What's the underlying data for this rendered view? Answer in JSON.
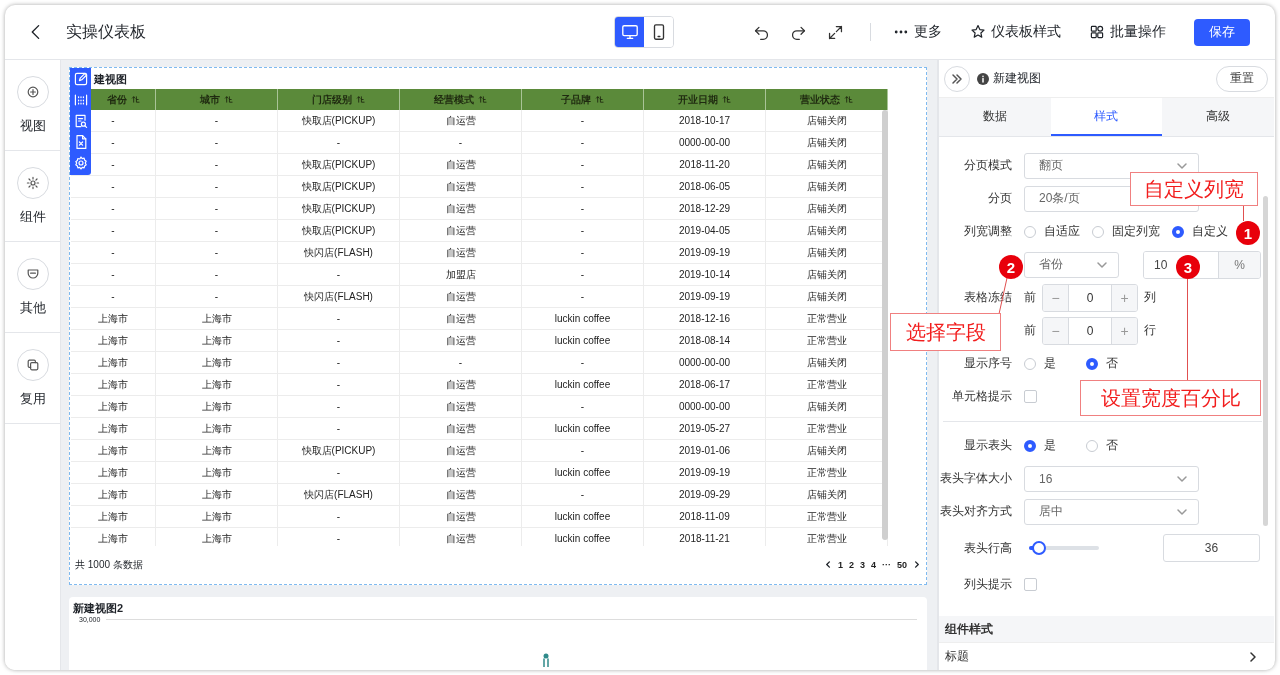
{
  "header": {
    "title": "实操仪表板",
    "devices": [
      {
        "kind": "desktop",
        "selected": true
      },
      {
        "kind": "mobile",
        "selected": false
      }
    ],
    "tools": [
      {
        "kind": "undo"
      },
      {
        "kind": "redo"
      },
      {
        "kind": "expand"
      }
    ],
    "menu": [
      {
        "kind": "more",
        "label": "更多"
      },
      {
        "kind": "style",
        "label": "仪表板样式"
      },
      {
        "kind": "batch",
        "label": "批量操作"
      }
    ],
    "save": "保存"
  },
  "sidebar": {
    "items": [
      {
        "kind": "add",
        "label": "视图"
      },
      {
        "kind": "component",
        "label": "组件"
      },
      {
        "kind": "other",
        "label": "其他"
      },
      {
        "kind": "reuse",
        "label": "复用"
      }
    ]
  },
  "table_view": {
    "title": "建视图",
    "tools": [
      {
        "kind": "edit"
      },
      {
        "kind": "grid"
      },
      {
        "kind": "search"
      },
      {
        "kind": "export"
      },
      {
        "kind": "settings"
      }
    ],
    "columns": [
      {
        "label": "省份",
        "sortable": true
      },
      {
        "label": "城市",
        "sortable": true
      },
      {
        "label": "门店级别",
        "sortable": true
      },
      {
        "label": "经营模式",
        "sortable": true
      },
      {
        "label": "子品牌",
        "sortable": true
      },
      {
        "label": "开业日期",
        "sortable": true
      },
      {
        "label": "营业状态",
        "sortable": true
      }
    ],
    "rows": [
      [
        "-",
        "-",
        "快取店(PICKUP)",
        "自运营",
        "-",
        "2018-10-17",
        "店铺关闭"
      ],
      [
        "-",
        "-",
        "-",
        "-",
        "-",
        "0000-00-00",
        "店铺关闭"
      ],
      [
        "-",
        "-",
        "快取店(PICKUP)",
        "自运营",
        "-",
        "2018-11-20",
        "店铺关闭"
      ],
      [
        "-",
        "-",
        "快取店(PICKUP)",
        "自运营",
        "-",
        "2018-06-05",
        "店铺关闭"
      ],
      [
        "-",
        "-",
        "快取店(PICKUP)",
        "自运营",
        "-",
        "2018-12-29",
        "店铺关闭"
      ],
      [
        "-",
        "-",
        "快取店(PICKUP)",
        "自运营",
        "-",
        "2019-04-05",
        "店铺关闭"
      ],
      [
        "-",
        "-",
        "快闪店(FLASH)",
        "自运营",
        "-",
        "2019-09-19",
        "店铺关闭"
      ],
      [
        "-",
        "-",
        "-",
        "加盟店",
        "-",
        "2019-10-14",
        "店铺关闭"
      ],
      [
        "-",
        "-",
        "快闪店(FLASH)",
        "自运营",
        "-",
        "2019-09-19",
        "店铺关闭"
      ],
      [
        "上海市",
        "上海市",
        "-",
        "自运营",
        "luckin coffee",
        "2018-12-16",
        "正常营业"
      ],
      [
        "上海市",
        "上海市",
        "-",
        "自运营",
        "luckin coffee",
        "2018-08-14",
        "正常营业"
      ],
      [
        "上海市",
        "上海市",
        "-",
        "-",
        "-",
        "0000-00-00",
        "店铺关闭"
      ],
      [
        "上海市",
        "上海市",
        "-",
        "自运营",
        "luckin coffee",
        "2018-06-17",
        "正常营业"
      ],
      [
        "上海市",
        "上海市",
        "-",
        "自运营",
        "-",
        "0000-00-00",
        "店铺关闭"
      ],
      [
        "上海市",
        "上海市",
        "-",
        "自运营",
        "luckin coffee",
        "2019-05-27",
        "正常营业"
      ],
      [
        "上海市",
        "上海市",
        "快取店(PICKUP)",
        "自运营",
        "-",
        "2019-01-06",
        "店铺关闭"
      ],
      [
        "上海市",
        "上海市",
        "-",
        "自运营",
        "luckin coffee",
        "2019-09-19",
        "正常营业"
      ],
      [
        "上海市",
        "上海市",
        "快闪店(FLASH)",
        "自运营",
        "-",
        "2019-09-29",
        "店铺关闭"
      ],
      [
        "上海市",
        "上海市",
        "-",
        "自运营",
        "luckin coffee",
        "2018-11-09",
        "正常营业"
      ],
      [
        "上海市",
        "上海市",
        "-",
        "自运营",
        "luckin coffee",
        "2018-11-21",
        "正常营业"
      ]
    ],
    "pager": {
      "total": "共 1000 条数据",
      "pages": [
        "1",
        "2",
        "3",
        "4",
        "···",
        "50"
      ]
    }
  },
  "chart_view": {
    "title": "新建视图2",
    "axis_label": "30,000"
  },
  "panel": {
    "title": "新建视图",
    "reset": "重置",
    "tabs": [
      {
        "label": "数据",
        "selected": false
      },
      {
        "label": "样式",
        "selected": true
      },
      {
        "label": "高级",
        "selected": false
      }
    ],
    "fields": [
      {
        "kind": "select",
        "label": "分页模式",
        "value": "翻页"
      },
      {
        "kind": "select",
        "label": "分页",
        "value": "20条/页"
      },
      {
        "kind": "radio",
        "label": "列宽调整",
        "options": [
          {
            "label": "自适应",
            "selected": false
          },
          {
            "label": "固定列宽",
            "selected": false
          },
          {
            "label": "自定义",
            "selected": true
          }
        ]
      },
      {
        "kind": "column_width",
        "select": "省份",
        "value": "10",
        "unit": "%"
      },
      {
        "kind": "stepper",
        "label": "表格冻结",
        "prefix": "前",
        "decrement": "−",
        "value": "0",
        "increment": "+",
        "suffix": "列"
      },
      {
        "kind": "stepper",
        "prefix": "前",
        "decrement": "−",
        "value": "0",
        "increment": "+",
        "suffix": "行"
      },
      {
        "kind": "radio",
        "label": "显示序号",
        "options": [
          {
            "label": "是",
            "selected": false
          },
          {
            "label": "否",
            "selected": true
          }
        ]
      },
      {
        "kind": "checkbox",
        "label": "单元格提示",
        "checked": false
      },
      {
        "kind": "divider"
      },
      {
        "kind": "radio",
        "label": "显示表头",
        "options": [
          {
            "label": "是",
            "selected": true
          },
          {
            "label": "否",
            "selected": false
          }
        ]
      },
      {
        "kind": "select",
        "label": "表头字体大小",
        "value": "16"
      },
      {
        "kind": "select",
        "label": "表头对齐方式",
        "value": "居中"
      },
      {
        "kind": "slider",
        "label": "表头行高",
        "level": 0.14,
        "value": "36"
      },
      {
        "kind": "checkbox",
        "label": "列头提示",
        "checked": false
      }
    ],
    "sections": [
      {
        "kind": "group",
        "title": "组件样式"
      },
      {
        "kind": "collapsible",
        "title": "标题"
      }
    ]
  },
  "notes": [
    {
      "kind": "custom_width",
      "number": "1",
      "text": "自定义列宽"
    },
    {
      "kind": "pick_field",
      "number": "2",
      "text": "选择字段"
    },
    {
      "kind": "percent",
      "number": "3",
      "text": "设置宽度百分比"
    }
  ]
}
